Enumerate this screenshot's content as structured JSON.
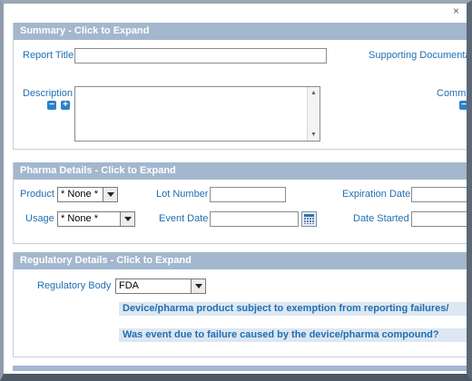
{
  "window": {
    "close_glyph": "×"
  },
  "summary": {
    "header": "Summary - Click to Expand",
    "report_title_label": "Report Title",
    "report_title_value": "",
    "supporting_label": "Supporting Documenta",
    "description_label": "Description",
    "description_value": "",
    "comments_label": "Comm"
  },
  "pharma": {
    "header": "Pharma Details - Click to Expand",
    "product_label": "Product",
    "product_value": "* None *",
    "usage_label": "Usage",
    "usage_value": "* None *",
    "lot_label": "Lot Number",
    "lot_value": "",
    "event_date_label": "Event Date",
    "event_date_value": "",
    "expiration_label": "Expiration Date",
    "expiration_value": "",
    "date_started_label": "Date Started",
    "date_started_value": ""
  },
  "regulatory": {
    "header": "Regulatory Details - Click to Expand",
    "body_label": "Regulatory Body",
    "body_value": "FDA",
    "question1": "Device/pharma product subject to exemption from reporting failures/",
    "question2": "Was event due to failure caused by the device/pharma compound?"
  },
  "icons": {
    "collapse": "minus-icon",
    "expand": "plus-icon",
    "calendar": "calendar-icon"
  },
  "colors": {
    "section_header_bg": "#a3b7ce",
    "label_blue": "#1f6fb2",
    "question_bg": "#dde7f1"
  }
}
